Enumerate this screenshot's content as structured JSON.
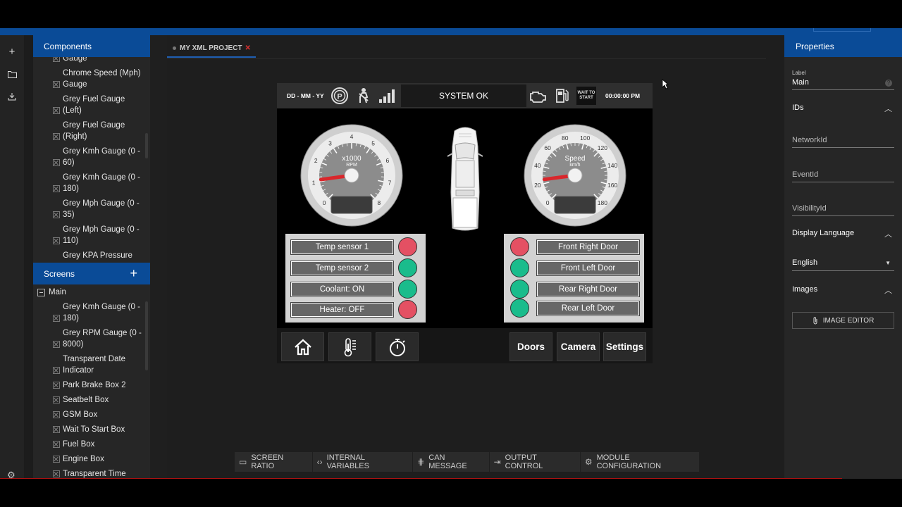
{
  "left_panel": {
    "components_title": "Components",
    "components": [
      "Gauge",
      "Chrome Speed (Mph) Gauge",
      "Grey Fuel Gauge (Left)",
      "Grey Fuel Gauge (Right)",
      "Grey Kmh Gauge (0 - 60)",
      "Grey Kmh Gauge (0 - 180)",
      "Grey Mph Gauge (0 - 35)",
      "Grey Mph Gauge (0 - 110)",
      "Grey KPA Pressure Gauge"
    ],
    "screens_title": "Screens",
    "screen_root": "Main",
    "screen_items": [
      "Grey Kmh Gauge (0 - 180)",
      "Grey RPM Gauge (0 - 8000)",
      "Transparent Date Indicator",
      "Park Brake Box 2",
      "Seatbelt Box",
      "GSM Box",
      "Wait To Start Box",
      "Fuel Box",
      "Engine Box",
      "Transparent Time"
    ]
  },
  "tab": {
    "label": "MY XML PROJECT",
    "close": "✕"
  },
  "dashboard": {
    "date": "DD - MM - YY",
    "status": "SYSTEM OK",
    "time": "00:00:00 PM",
    "wait_to_start": "WAIT TO START",
    "park_letter": "P",
    "rpm_gauge": {
      "title": "x1000",
      "subtitle": "RPM",
      "ticks": [
        "0",
        "1",
        "2",
        "3",
        "4",
        "5",
        "6",
        "7",
        "8"
      ],
      "value": 1.1,
      "max": 8
    },
    "speed_gauge": {
      "title": "Speed",
      "subtitle": "km/h",
      "ticks": [
        "0",
        "20",
        "40",
        "60",
        "80",
        "100",
        "120",
        "140",
        "160",
        "180"
      ],
      "value": 25,
      "max": 180
    },
    "sensors": [
      {
        "label": "Temp sensor 1",
        "color": "red"
      },
      {
        "label": "Temp sensor 2",
        "color": "green"
      },
      {
        "label": "Coolant: ON",
        "color": "green"
      },
      {
        "label": "Heater: OFF",
        "color": "red"
      }
    ],
    "doors": [
      {
        "label": "Front Right Door",
        "color": "red"
      },
      {
        "label": "Front Left Door",
        "color": "green"
      },
      {
        "label": "Rear Right Door",
        "color": "green"
      },
      {
        "label": "Rear Left Door",
        "color": "green"
      }
    ],
    "buttons": {
      "doors": "Doors",
      "camera": "Camera",
      "settings": "Settings"
    },
    "colors": {
      "red": "#e45063",
      "green": "#1abc8c",
      "needle": "#d9262b"
    }
  },
  "toolbar": {
    "items": [
      {
        "icon": "▭",
        "label": "SCREEN RATIO"
      },
      {
        "icon": "‹›",
        "label": "INTERNAL VARIABLES"
      },
      {
        "icon": "⋕",
        "label": "CAN MESSAGE"
      },
      {
        "icon": "⇥",
        "label": "OUTPUT CONTROL"
      },
      {
        "icon": "⚙",
        "label": "MODULE CONFIGURATION"
      }
    ]
  },
  "properties": {
    "title": "Properties",
    "label_caption": "Label",
    "label_value": "Main",
    "ids_section": "IDs",
    "network_id": "NetworkId",
    "event_id": "EventId",
    "visibility_id": "VisibilityId",
    "display_language_section": "Display Language",
    "language": "English",
    "images_section": "Images",
    "image_editor": "IMAGE EDITOR"
  }
}
